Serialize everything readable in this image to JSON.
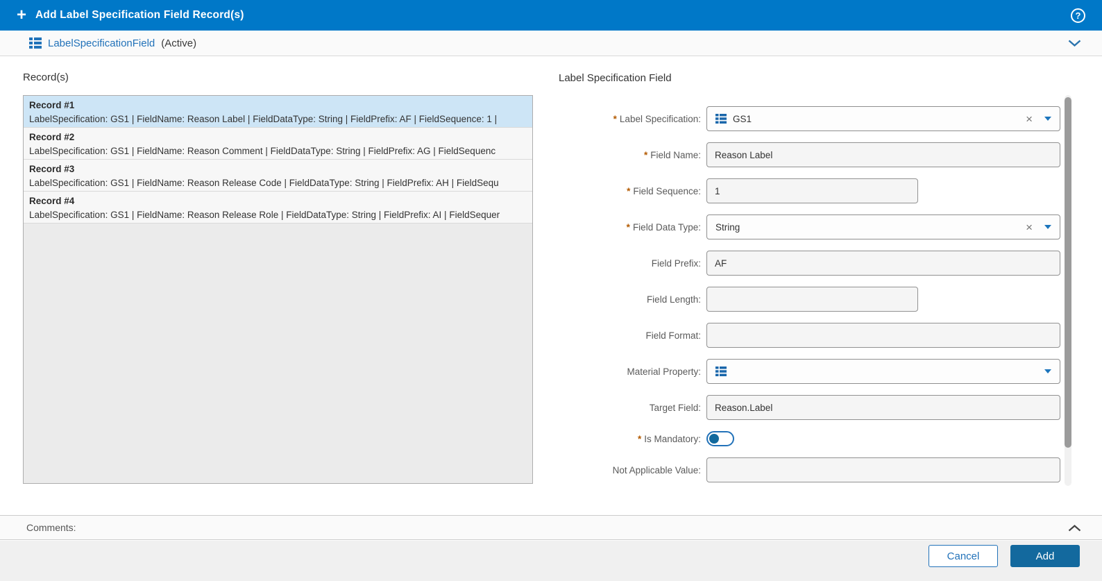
{
  "header": {
    "title": "Add Label Specification Field Record(s)"
  },
  "icons": {
    "plus": "+",
    "help": "?",
    "clear": "×",
    "required_marker": "*"
  },
  "subheader": {
    "entity": "LabelSpecificationField",
    "status": "(Active)"
  },
  "records": {
    "title": "Record(s)",
    "items": [
      {
        "name": "Record #1",
        "summary": "LabelSpecification: GS1 | FieldName: Reason Label | FieldDataType: String | FieldPrefix: AF | FieldSequence: 1 |",
        "selected": true
      },
      {
        "name": "Record #2",
        "summary": "LabelSpecification: GS1 | FieldName: Reason Comment | FieldDataType: String | FieldPrefix: AG | FieldSequenc",
        "selected": false
      },
      {
        "name": "Record #3",
        "summary": "LabelSpecification: GS1 | FieldName: Reason Release Code | FieldDataType: String | FieldPrefix: AH | FieldSequ",
        "selected": false
      },
      {
        "name": "Record #4",
        "summary": "LabelSpecification: GS1 | FieldName: Reason Release Role | FieldDataType: String | FieldPrefix: AI | FieldSequer",
        "selected": false
      }
    ]
  },
  "form": {
    "title": "Label Specification Field",
    "label_specification": {
      "label": "Label Specification:",
      "value": "GS1",
      "required": true
    },
    "field_name": {
      "label": "Field Name:",
      "value": "Reason Label",
      "required": true
    },
    "field_sequence": {
      "label": "Field Sequence:",
      "value": "1",
      "required": true
    },
    "field_data_type": {
      "label": "Field Data Type:",
      "value": "String",
      "required": true
    },
    "field_prefix": {
      "label": "Field Prefix:",
      "value": "AF",
      "required": false
    },
    "field_length": {
      "label": "Field Length:",
      "value": "",
      "required": false
    },
    "field_format": {
      "label": "Field Format:",
      "value": "",
      "required": false
    },
    "material_property": {
      "label": "Material Property:",
      "value": "",
      "required": false
    },
    "target_field": {
      "label": "Target Field:",
      "value": "Reason.Label",
      "required": false
    },
    "is_mandatory": {
      "label": "Is Mandatory:",
      "state": "off",
      "required": true
    },
    "not_applicable_value": {
      "label": "Not Applicable Value:",
      "value": "",
      "required": false
    }
  },
  "comments": {
    "label": "Comments:"
  },
  "footer": {
    "cancel": "Cancel",
    "add": "Add"
  },
  "colors": {
    "header_blue": "#0078c8",
    "accent_blue": "#2272b9",
    "add_button_blue": "#13699e",
    "selected_record_bg": "#cde5f6",
    "required_asterisk": "#b35a00"
  }
}
